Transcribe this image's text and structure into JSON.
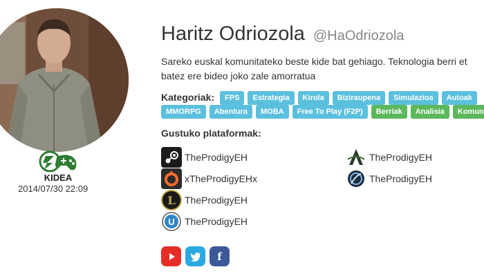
{
  "profile": {
    "name": "Haritz Odriozola",
    "handle": "@HaOdriozola",
    "bio_line1": "Sareko euskal komunitateko beste kide bat gehiago. Teknologia berri et",
    "bio_line2": "batez ere bideo joko zale amorratua",
    "joined": "2014/07/30 22:09",
    "logo_text": "KIDEA"
  },
  "categories": {
    "label": "Kategoriak:",
    "row1": [
      {
        "label": "FPS",
        "color": "blue"
      },
      {
        "label": "Estrategia",
        "color": "blue"
      },
      {
        "label": "Kirola",
        "color": "blue"
      },
      {
        "label": "Biziraupena",
        "color": "blue"
      },
      {
        "label": "Simulazioa",
        "color": "blue"
      },
      {
        "label": "Autoak",
        "color": "blue"
      }
    ],
    "row2": [
      {
        "label": "MMORPG",
        "color": "blue"
      },
      {
        "label": "Abentura",
        "color": "blue"
      },
      {
        "label": "MOBA",
        "color": "blue"
      },
      {
        "label": "Free To Play (F2P)",
        "color": "blue"
      },
      {
        "label": "Berriak",
        "color": "green"
      },
      {
        "label": "Analisia",
        "color": "green"
      },
      {
        "label": "Komunitat",
        "color": "green"
      }
    ]
  },
  "platforms": {
    "label": "Gustuko plataformak:",
    "items": [
      {
        "icon": "steam-icon",
        "name": "TheProdigyEH"
      },
      {
        "icon": "origin-icon",
        "name": "xTheProdigyEHx"
      },
      {
        "icon": "league-of-legends-icon",
        "name": "TheProdigyEH"
      },
      {
        "icon": "uplay-icon",
        "name": "TheProdigyEH"
      },
      {
        "icon": "archeage-icon",
        "name": "TheProdigyEH"
      },
      {
        "icon": "battlenet-icon",
        "name": "TheProdigyEH"
      }
    ]
  },
  "social": {
    "youtube_icon": "youtube-icon",
    "twitter_icon": "twitter-icon",
    "facebook_icon": "facebook-icon",
    "facebook_glyph": "f"
  },
  "colors": {
    "tag_blue": "#5bc0de",
    "tag_green": "#5cb85c",
    "youtube": "#e52d27",
    "twitter": "#2aa9e0",
    "facebook": "#3b5998"
  }
}
